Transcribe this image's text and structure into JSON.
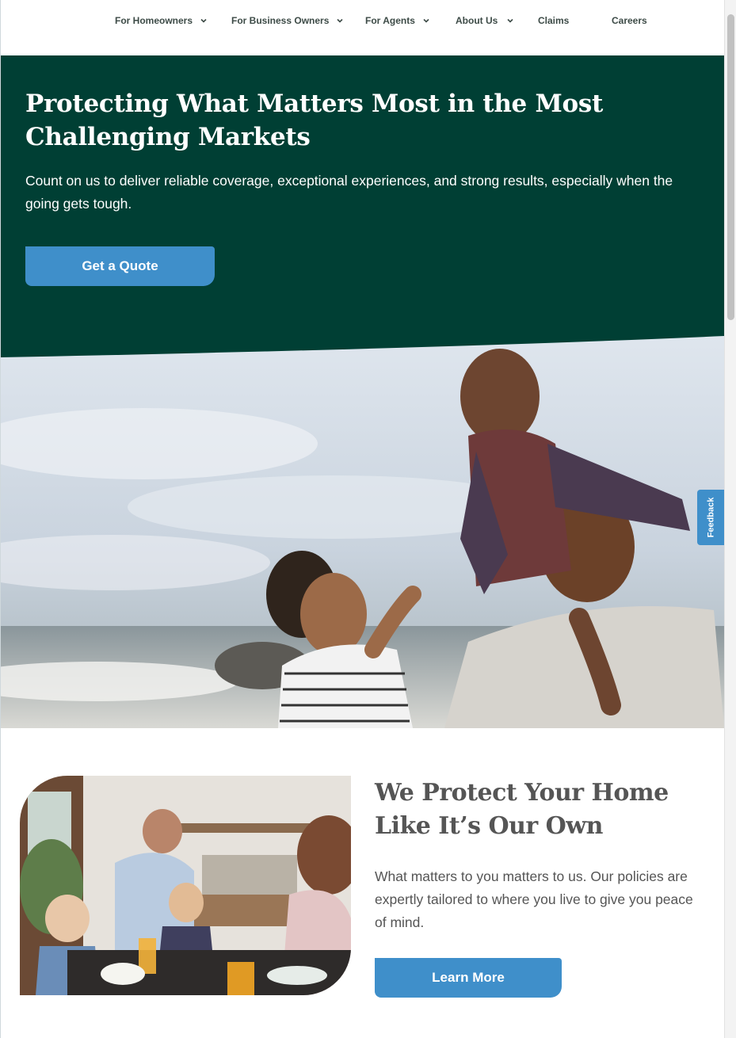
{
  "nav": {
    "items": [
      {
        "label": "For Homeowners",
        "has_dropdown": true
      },
      {
        "label": "For Business Owners",
        "has_dropdown": true
      },
      {
        "label": "For Agents",
        "has_dropdown": true
      },
      {
        "label": "About Us",
        "has_dropdown": true
      },
      {
        "label": "Claims",
        "has_dropdown": false
      },
      {
        "label": "Careers",
        "has_dropdown": false
      }
    ]
  },
  "hero": {
    "title": "Protecting What Matters Most in the Most Challenging Markets",
    "subtitle": "Count on us to deliver reliable coverage, exceptional experiences, and strong results, especially when the going gets tough.",
    "cta_label": "Get a Quote",
    "image_icon": "family-beach-photo"
  },
  "feedback": {
    "label": "Feedback"
  },
  "home_section": {
    "title": "We Protect Your Home Like It’s Our Own",
    "body": "What matters to you matters to us. Our policies are expertly tailored to where you live to give you peace of mind.",
    "cta_label": "Learn More",
    "image_icon": "family-kitchen-photo"
  },
  "colors": {
    "hero_bg": "#003f34",
    "accent_blue": "#3f8fca",
    "nav_text": "#3d4b47",
    "heading_gray": "#555555"
  }
}
